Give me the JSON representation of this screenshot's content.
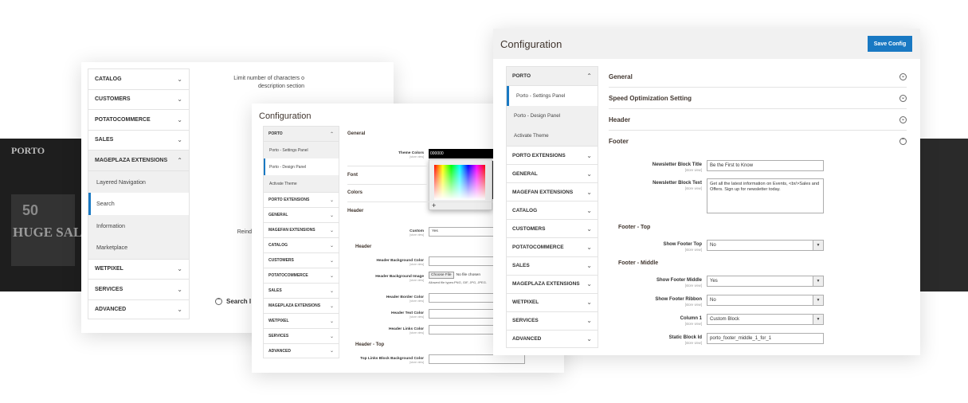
{
  "background": {
    "logo": "PORTO",
    "promo_number": "50",
    "promo_text": "HUGE SALE"
  },
  "panel1": {
    "nav_top": [
      "CATALOG",
      "CUSTOMERS",
      "POTATOCOMMERCE",
      "SALES"
    ],
    "nav_open": "MAGEPLAZA EXTENSIONS",
    "sub_items": [
      "Layered Navigation",
      "Search",
      "Information",
      "Marketplace"
    ],
    "sub_active_index": 1,
    "nav_bottom": [
      "WETPIXEL",
      "SERVICES",
      "ADVANCED"
    ],
    "limit_label": "Limit number of characters o description section",
    "reindex_label": "Reind",
    "search_section": "Search I"
  },
  "panel2": {
    "title": "Configuration",
    "nav_head": "PORTO",
    "sub_items": [
      "Porto - Settings Panel",
      "Porto - Design Panel",
      "Activate Theme"
    ],
    "sub_active_index": 1,
    "nav_items": [
      "PORTO EXTENSIONS",
      "GENERAL",
      "MAGEFAN EXTENSIONS",
      "CATALOG",
      "CUSTOMERS",
      "POTATOCOMMERCE",
      "SALES",
      "MAGEPLAZA EXTENSIONS",
      "WETPIXEL",
      "SERVICES",
      "ADVANCED"
    ],
    "sections": {
      "general": "General",
      "font": "Font",
      "colors": "Colors",
      "header": "Header"
    },
    "scope": "[store view]",
    "theme_colors_label": "Theme Colors",
    "theme_colors_value": "000000",
    "custom_label": "Custom",
    "custom_value": "Yes",
    "header_sub": "Header",
    "header_bg_color": "Header Background Color",
    "header_bg_image": "Header Background Image",
    "choose_file": "Choose File",
    "no_file": "No file chosen",
    "allowed_types": "Allowed file types:PNG, GIF, JPG, JPEG.",
    "header_border_color": "Header Border Color",
    "header_text_color": "Header Text Color",
    "header_links_color": "Header Links Color",
    "header_top": "Header - Top",
    "top_links_bg": "Top Links Block Background Color"
  },
  "panel3": {
    "title": "Configuration",
    "save_button": "Save Config",
    "nav_head": "PORTO",
    "sub_items": [
      "Porto - Settings Panel",
      "Porto - Design Panel",
      "Activate Theme"
    ],
    "sub_active_index": 0,
    "nav_items": [
      "PORTO EXTENSIONS",
      "GENERAL",
      "MAGEFAN EXTENSIONS",
      "CATALOG",
      "CUSTOMERS",
      "POTATOCOMMERCE",
      "SALES",
      "MAGEPLAZA EXTENSIONS",
      "WETPIXEL",
      "SERVICES",
      "ADVANCED"
    ],
    "accordions": [
      "General",
      "Speed Optimization Setting",
      "Header",
      "Footer"
    ],
    "scope": "[store view]",
    "newsletter_title_label": "Newsletter Block Title",
    "newsletter_title_value": "Be the First to Know",
    "newsletter_text_label": "Newsletter Block Text",
    "newsletter_text_value": "Get all the latest information on Events, <br/>Sales and Offers. Sign up for newsletter today.",
    "footer_top": "Footer - Top",
    "show_footer_top_label": "Show Footer Top",
    "show_footer_top_value": "No",
    "footer_middle": "Footer - Middle",
    "show_footer_middle_label": "Show Footer Middle",
    "show_footer_middle_value": "Yes",
    "show_footer_ribbon_label": "Show Footer Ribbon",
    "show_footer_ribbon_value": "No",
    "column1_label": "Column 1",
    "column1_value": "Custom Block",
    "static_block_label": "Static Block Id",
    "static_block_value": "porto_footer_middle_1_for_1"
  },
  "colors": {
    "accent": "#1979c3",
    "heading": "#41362f"
  }
}
